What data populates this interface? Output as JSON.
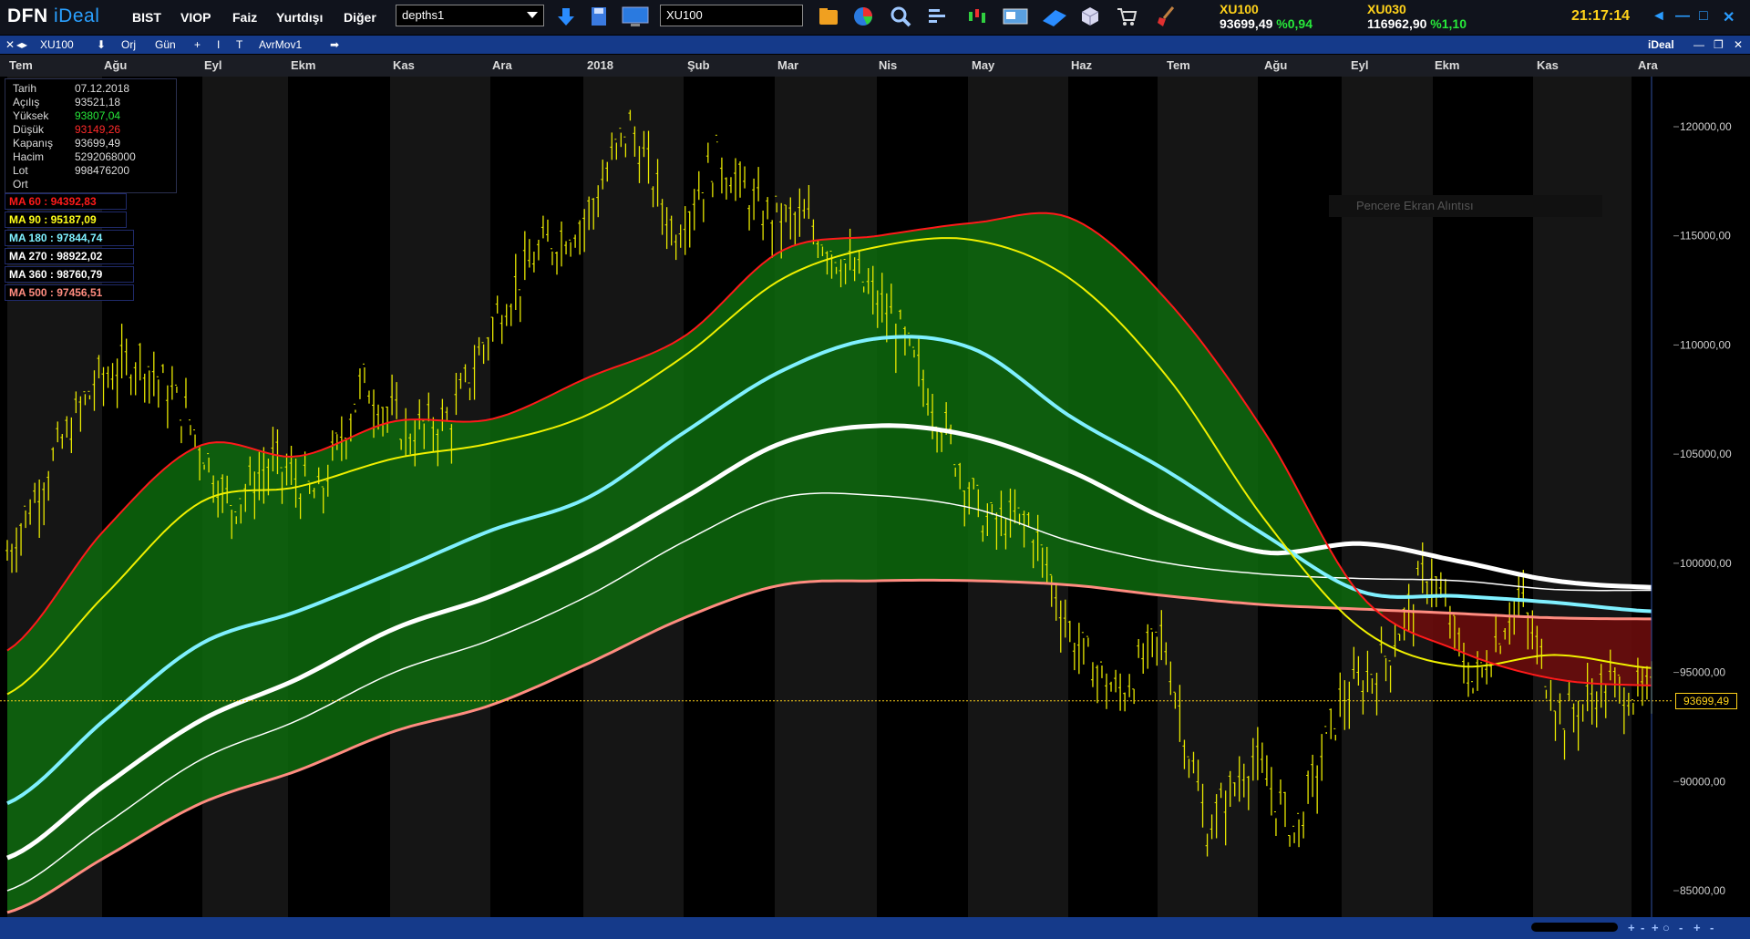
{
  "app": {
    "logo_a": "DFN",
    "logo_b": "iDeal"
  },
  "menu": [
    "BIST",
    "VIOP",
    "Faiz",
    "Yurtdışı",
    "Diğer"
  ],
  "layout_select": {
    "value": "depths1"
  },
  "symbol_input": {
    "value": "XU100"
  },
  "toolbar_icons": [
    "download-icon",
    "save-icon",
    "monitor-icon",
    "folder-icon",
    "pie-chart-icon",
    "search-icon",
    "bar-list-icon",
    "candlestick-icon",
    "news-icon",
    "book-icon",
    "cube-icon",
    "cart-icon",
    "broom-icon"
  ],
  "quotes": [
    {
      "name": "XU100",
      "value": "93699,49",
      "pct": "%0,94"
    },
    {
      "name": "XU030",
      "value": "116962,90",
      "pct": "%1,10"
    }
  ],
  "clock": "21:17:14",
  "window_buttons": [
    "◄",
    "—",
    "□",
    "✕"
  ],
  "chart_toolbar": {
    "symbol": "XU100",
    "items": [
      "⬇",
      "Orj",
      "Gün",
      "+",
      "I",
      "T",
      "AvrMov1",
      "➡"
    ],
    "brand": "iDeal"
  },
  "time_labels": [
    "Tem",
    "Ağu",
    "Eyl",
    "Ekm",
    "Kas",
    "Ara",
    "2018",
    "Şub",
    "Mar",
    "Nis",
    "May",
    "Haz",
    "Tem",
    "Ağu",
    "Eyl",
    "Ekm",
    "Kas",
    "Ara"
  ],
  "info": [
    {
      "k": "Tarih",
      "v": "07.12.2018",
      "color": "#dcdcdc"
    },
    {
      "k": "Açılış",
      "v": "93521,18",
      "color": "#dcdcdc"
    },
    {
      "k": "Yüksek",
      "v": "93807,04",
      "color": "#27e83a"
    },
    {
      "k": "Düşük",
      "v": "93149,26",
      "color": "#ff2a2a"
    },
    {
      "k": "Kapanış",
      "v": "93699,49",
      "color": "#dcdcdc"
    },
    {
      "k": "Hacim",
      "v": "5292068000",
      "color": "#dcdcdc"
    },
    {
      "k": "Lot",
      "v": "998476200",
      "color": "#dcdcdc"
    },
    {
      "k": "Ort",
      "v": "",
      "color": "#dcdcdc"
    }
  ],
  "ma_labels": [
    {
      "text": "MA 60 : 94392,83",
      "color": "#ff1a1a"
    },
    {
      "text": "MA 90 : 95187,09",
      "color": "#ffff1a"
    },
    {
      "text": "MA 180 : 97844,74",
      "color": "#7ff0ff"
    },
    {
      "text": "MA 270 : 98922,02",
      "color": "#ffffff"
    },
    {
      "text": "MA 360 : 98760,79",
      "color": "#ffffff"
    },
    {
      "text": "MA 500 : 97456,51",
      "color": "#ff8c80"
    }
  ],
  "ghost_text": "Pencere Ekran Alıntısı",
  "last_price_tag": "93699,49",
  "colors": {
    "price": "#e8e800",
    "ma60": "#ff1a1a",
    "ma90": "#f0f000",
    "ma180": "#7ff0ff",
    "ma270": "#ffffff",
    "ma360": "#ffffff",
    "ma500": "#ff8c80",
    "fill_up": "#0d6a0d",
    "fill_down": "#6a0c0c"
  },
  "chart_data": {
    "type": "line",
    "title": "",
    "yaxis": {
      "ticks": [
        "120000,00",
        "115000,00",
        "110000,00",
        "105000,00",
        "100000,00",
        "95000,00",
        "90000,00",
        "85000,00"
      ],
      "ylim": [
        84000,
        122500
      ]
    },
    "x_labels": [
      "Tem",
      "Ağu",
      "Eyl",
      "Ekm",
      "Kas",
      "Ara",
      "2018",
      "Şub",
      "Mar",
      "Nis",
      "May",
      "Haz",
      "Tem",
      "Ağu",
      "Eyl",
      "Ekm",
      "Kas",
      "Ara"
    ],
    "price_close": [
      100300,
      104500,
      108200,
      109300,
      106800,
      102500,
      104500,
      102800,
      108200,
      105800,
      106500,
      111200,
      114200,
      115600,
      120000,
      115000,
      118500,
      115800,
      115500,
      113300,
      110800,
      106500,
      101700,
      101800,
      96300,
      93800,
      96600,
      87600,
      91000,
      87500,
      93500,
      95400,
      99700,
      94200,
      98400,
      92700,
      94300,
      93700
    ],
    "series": [
      {
        "name": "MA 60",
        "values": [
          96000,
          101500,
          105400,
          104900,
          106500,
          106600,
          108500,
          110400,
          114300,
          115000,
          115600,
          115800,
          112000,
          106000,
          98500,
          96000,
          94700,
          94400
        ]
      },
      {
        "name": "MA 90",
        "values": [
          94000,
          98500,
          102800,
          103500,
          104800,
          105500,
          106800,
          109500,
          113000,
          114500,
          114800,
          113000,
          108500,
          102000,
          97000,
          95300,
          95800,
          95200
        ]
      },
      {
        "name": "MA 180",
        "values": [
          89000,
          92800,
          96300,
          97800,
          99600,
          101500,
          103000,
          106000,
          108800,
          110300,
          109800,
          106700,
          104200,
          101300,
          98700,
          98500,
          98200,
          97800
        ]
      },
      {
        "name": "MA 270",
        "values": [
          86500,
          89800,
          92800,
          94700,
          97000,
          98500,
          100500,
          103000,
          105500,
          106300,
          105800,
          104200,
          102000,
          100500,
          100900,
          100100,
          99200,
          98900
        ]
      },
      {
        "name": "MA 360",
        "values": [
          85000,
          88000,
          91000,
          92800,
          95000,
          96500,
          98500,
          101000,
          103000,
          103100,
          102500,
          101000,
          100000,
          99500,
          99300,
          99200,
          98800,
          98760
        ]
      },
      {
        "name": "MA 500",
        "values": [
          84000,
          86500,
          89000,
          90500,
          92300,
          93500,
          95400,
          97500,
          99000,
          99200,
          99200,
          99000,
          98500,
          98100,
          97900,
          97700,
          97500,
          97450
        ]
      }
    ]
  },
  "bottom_controls": [
    "+",
    "-",
    "+",
    "○",
    "-",
    "+",
    "-"
  ]
}
